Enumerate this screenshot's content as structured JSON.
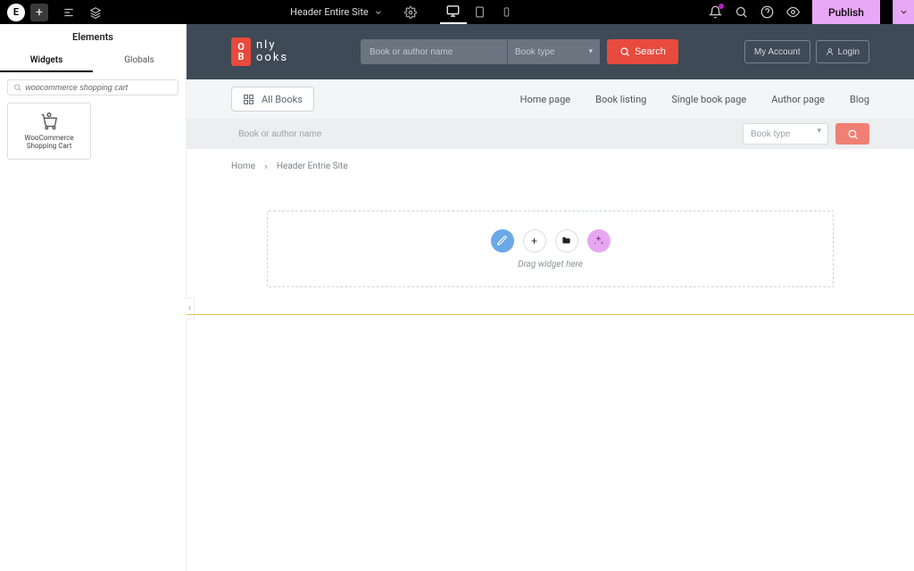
{
  "topbar": {
    "title": "Header Entire Site",
    "publish": "Publish"
  },
  "panel": {
    "title": "Elements",
    "tabs": {
      "widgets": "Widgets",
      "globals": "Globals"
    },
    "search_value": "woocommerce shopping cart",
    "widget_label": "WooCommerce Shopping Cart"
  },
  "site": {
    "logo": {
      "line1": "nly",
      "line2": "ooks",
      "sq1": "O",
      "sq2": "B"
    },
    "search_placeholder": "Book or author name",
    "type_label": "Book type",
    "search_btn": "Search",
    "my_account": "My Account",
    "login": "Login",
    "all_books": "All Books",
    "nav": {
      "home": "Home page",
      "listing": "Book listing",
      "single": "Single book page",
      "author": "Author page",
      "blog": "Blog"
    }
  },
  "sub": {
    "placeholder": "Book or author name",
    "type": "Book type"
  },
  "crumb": {
    "home": "Home",
    "current": "Header Entrie Site"
  },
  "drop": {
    "hint": "Drag widget here"
  }
}
